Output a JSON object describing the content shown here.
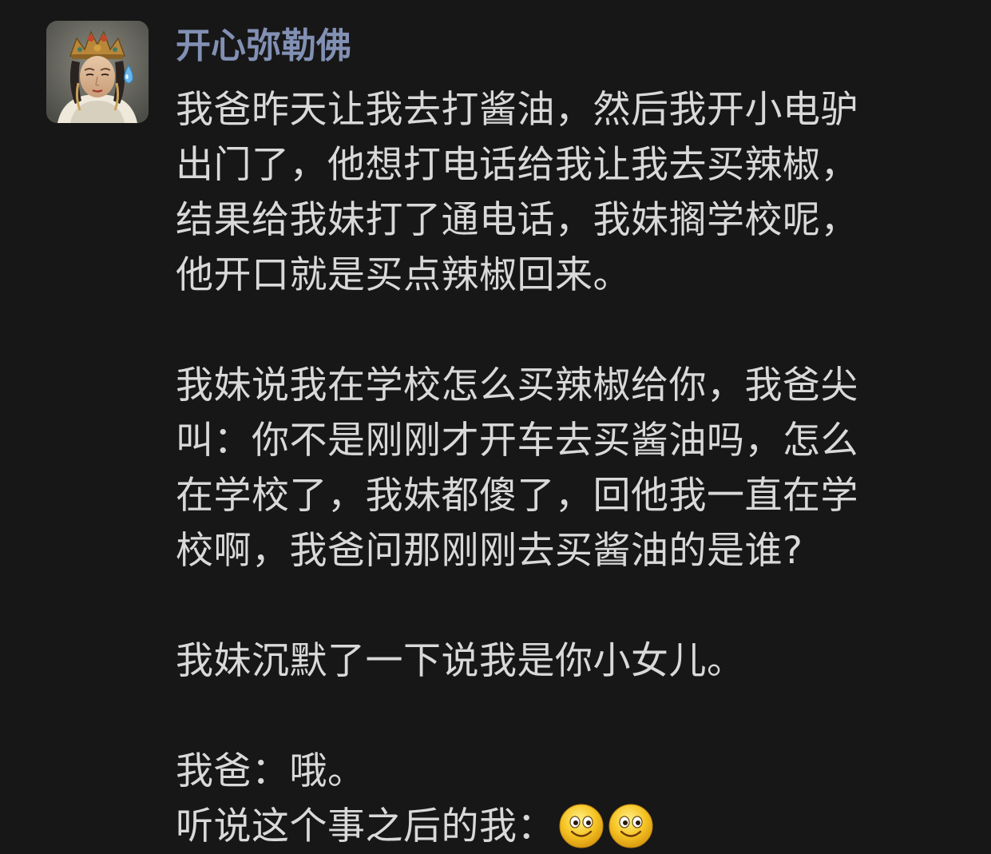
{
  "post": {
    "username": "开心弥勒佛",
    "avatar": "bodhisattva-statue-with-sweat-drop",
    "paragraph1": {
      "line1": "我爸昨天让我去打酱油，然后我开小电驴",
      "line2": "出门了，他想打电话给我让我去买辣椒，",
      "line3": "结果给我妹打了通电话，我妹搁学校呢，",
      "line4": "他开口就是买点辣椒回来。"
    },
    "paragraph2": {
      "line1": "我妹说我在学校怎么买辣椒给你，我爸尖",
      "line2": "叫：你不是刚刚才开车去买酱油吗，怎么",
      "line3": "在学校了，我妹都傻了，回他我一直在学",
      "line4": "校啊，我爸问那刚刚去买酱油的是谁?"
    },
    "paragraph3": {
      "line1": "我妹沉默了一下说我是你小女儿。"
    },
    "paragraph4": {
      "line1": "我爸：哦。",
      "line2": "听说这个事之后的我："
    },
    "emojis": [
      "smiling-face-emoji",
      "smiling-face-emoji"
    ]
  },
  "colors": {
    "background": "#171717",
    "username": "#8290b4",
    "text": "#d9d9d9",
    "emoji": "#f5c323"
  }
}
